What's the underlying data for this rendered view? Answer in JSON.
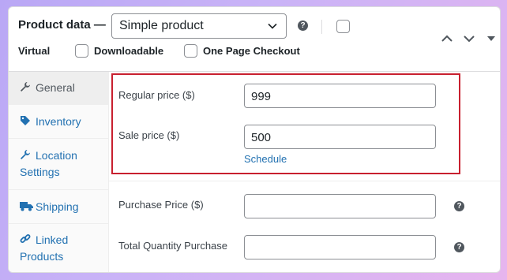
{
  "header": {
    "title": "Product data —",
    "product_type": "Simple product",
    "help_glyph": "?",
    "options": {
      "virtual": "Virtual",
      "downloadable": "Downloadable",
      "one_page_checkout": "One Page Checkout"
    }
  },
  "tabs": [
    {
      "label": "General",
      "icon": "wrench-icon"
    },
    {
      "label": "Inventory",
      "icon": "tag-icon"
    },
    {
      "label": "Location Settings",
      "line1": "Location",
      "line2": "Settings",
      "icon": "wrench-icon"
    },
    {
      "label": "Shipping",
      "icon": "truck-icon"
    },
    {
      "label": "Linked Products",
      "line1": "Linked",
      "line2": "Products",
      "icon": "link-icon"
    }
  ],
  "general": {
    "regular_price_label": "Regular price ($)",
    "regular_price_value": "999",
    "sale_price_label": "Sale price ($)",
    "sale_price_value": "500",
    "schedule_link": "Schedule",
    "purchase_price_label": "Purchase Price ($)",
    "purchase_price_value": "",
    "total_quantity_label": "Total Quantity Purchase",
    "total_quantity_value": ""
  },
  "colors": {
    "accent": "#2271b1",
    "highlight_border": "#c8202f"
  }
}
